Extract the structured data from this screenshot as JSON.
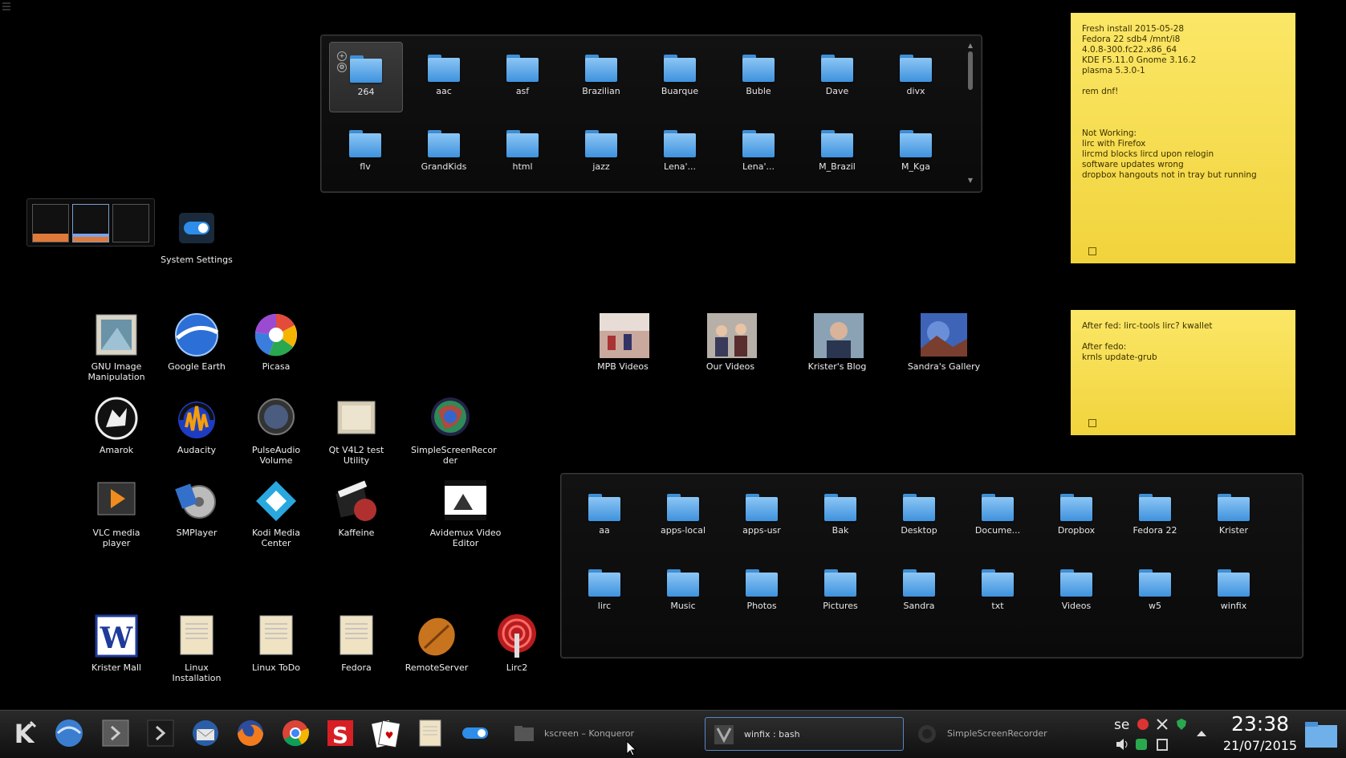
{
  "folder_panel_top": {
    "items": [
      "264",
      "aac",
      "asf",
      "Brazilian",
      "Buarque",
      "Buble",
      "Dave",
      "divx",
      "flv",
      "GrandKids",
      "html",
      "jazz",
      "Lena'...",
      "Lena'...",
      "M_Brazil",
      "M_Kga"
    ]
  },
  "folder_panel_bottom": {
    "items": [
      "aa",
      "apps-local",
      "apps-usr",
      "Bak",
      "Desktop",
      "Docume...",
      "Dropbox",
      "Fedora 22",
      "Krister",
      "lirc",
      "Music",
      "Photos",
      "Pictures",
      "Sandra",
      "txt",
      "Videos",
      "w5",
      "winfix"
    ]
  },
  "desktop_icons": {
    "system_settings": "System Settings",
    "gimp": "GNU Image Manipulation",
    "google_earth": "Google Earth",
    "picasa": "Picasa",
    "amarok": "Amarok",
    "audacity": "Audacity",
    "pulseaudio": "PulseAudio Volume",
    "qtv4l2": "Qt V4L2 test Utility",
    "ssr": "SimpleScreenRecor der",
    "vlc": "VLC media player",
    "smplayer": "SMPlayer",
    "kodi": "Kodi Media Center",
    "kaffeine": "Kaffeine",
    "avidemux": "Avidemux Video Editor",
    "krister_mall": "Krister Mall",
    "linux_installation": "Linux Installation",
    "linux_todo": "Linux ToDo",
    "fedora": "Fedora",
    "remoteserver": "RemoteServer",
    "lirc2": "Lirc2",
    "mpb_videos": "MPB Videos",
    "our_videos": "Our Videos",
    "kristers_blog": "Krister's Blog",
    "sandras_gallery": "Sandra's Gallery"
  },
  "notes": {
    "note1": "Fresh install 2015-05-28\nFedora 22  sdb4 /mnt/i8\n4.0.8-300.fc22.x86_64\nKDE F5.11.0  Gnome 3.16.2\nplasma 5.3.0-1\n\nrem dnf!\n\n\n\nNot Working:\nlirc with Firefox\nlircmd blocks lircd upon relogin\nsoftware updates wrong\ndropbox hangouts not in tray but running",
    "note2": "After fed: lirc-tools lirc? kwallet\n\nAfter fedo:\nkrnls update-grub"
  },
  "taskbar": {
    "tasks": [
      {
        "label": "kscreen – Konqueror"
      },
      {
        "label": "winfix : bash"
      },
      {
        "label": "SimpleScreenRecorder"
      }
    ],
    "keyboard_layout": "se",
    "clock_time": "23:38",
    "clock_date": "21/07/2015"
  },
  "colors": {
    "folder": "#5aa8ea",
    "note": "#f6dd4e",
    "active_task_border": "#5a86c5"
  }
}
